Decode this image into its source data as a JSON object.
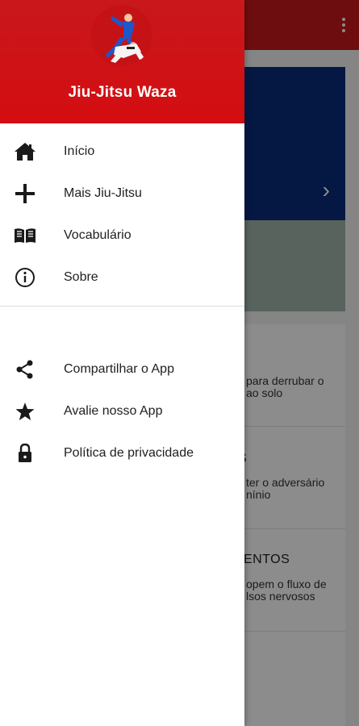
{
  "app": {
    "title": "Jiu-Jitsu Waza"
  },
  "drawer": {
    "primary_items": [
      {
        "label": "Início",
        "icon": "home-icon"
      },
      {
        "label": "Mais Jiu-Jitsu",
        "icon": "plus-icon"
      },
      {
        "label": "Vocabulário",
        "icon": "book-icon"
      },
      {
        "label": "Sobre",
        "icon": "info-icon"
      }
    ],
    "secondary_items": [
      {
        "label": "Compartilhar o App",
        "icon": "share-icon"
      },
      {
        "label": "Avalie nosso App",
        "icon": "star-icon"
      },
      {
        "label": "Política de privacidade",
        "icon": "lock-icon"
      }
    ]
  },
  "background": {
    "cards": [
      {
        "title": "",
        "desc_line1": "para derrubar o",
        "desc_line2": "ao solo"
      },
      {
        "title": "S",
        "desc_line1": "ter o adversário",
        "desc_line2": "nínio"
      },
      {
        "title": "IENTOS",
        "desc_line1": "opem o fluxo de",
        "desc_line2": "lsos nervosos"
      }
    ]
  },
  "colors": {
    "brand_red": "#c8181c",
    "banner_blue": "#0a2a7a"
  }
}
